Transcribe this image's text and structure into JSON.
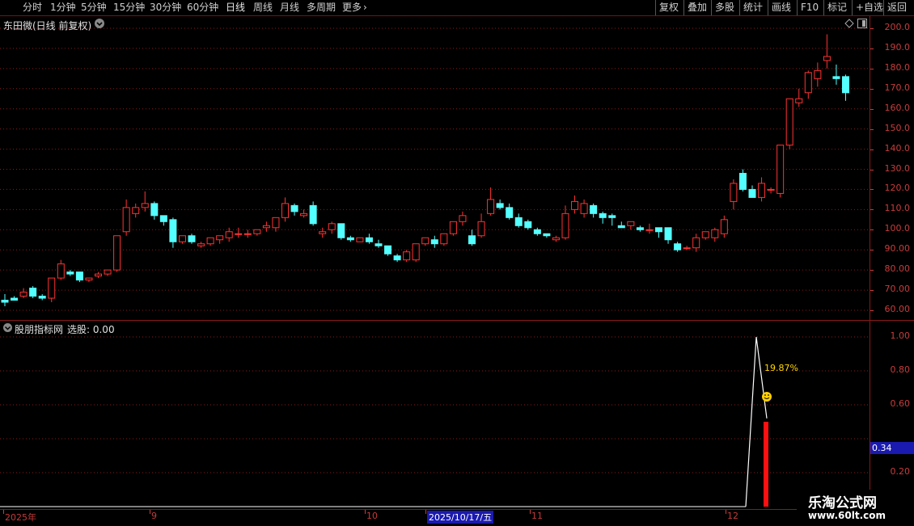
{
  "toolbar": {
    "periods": [
      "分时",
      "1分钟",
      "5分钟",
      "15分钟",
      "30分钟",
      "60分钟",
      "日线",
      "周线",
      "月线",
      "多周期",
      "更多"
    ],
    "active": "日线",
    "more_chevron": "›",
    "right_buttons": [
      "复权",
      "叠加",
      "多股",
      "统计",
      "画线",
      "F10",
      "标记",
      "+自选",
      "返回"
    ]
  },
  "main_panel": {
    "title": "东田微(日线 前复权)",
    "y_ticks": [
      "200.0",
      "190.0",
      "180.0",
      "170.0",
      "160.0",
      "150.0",
      "140.0",
      "130.0",
      "120.0",
      "110.0",
      "100.0",
      "90.00",
      "80.00",
      "70.00",
      "60.00"
    ]
  },
  "sub_panel": {
    "title": "股朋指标网",
    "select_label": "选股: 0.00",
    "y_ticks": [
      "1.00",
      "0.80",
      "0.60",
      "0.40",
      "0.20"
    ],
    "current_value": "0.34",
    "annotation": "19.87%"
  },
  "date_axis": {
    "labels": [
      "2025年",
      "9",
      "10",
      "2025/10/17/五",
      "11",
      "12"
    ]
  },
  "watermark": {
    "line1": "乐淘公式网",
    "line2": "www.60lt.com"
  },
  "colors": {
    "up": "#ff3232",
    "down": "#54ffff",
    "axis": "#c83c3c",
    "grid": "#8b1a1a",
    "highlight_bg": "#1a1ab0"
  },
  "chart_data": {
    "type": "candlestick",
    "ylim": [
      55,
      205
    ],
    "candles": [
      [
        65,
        68,
        64,
        62
      ],
      [
        66,
        67,
        65,
        65
      ],
      [
        67,
        71,
        69,
        66
      ],
      [
        71,
        72,
        67,
        66
      ],
      [
        67,
        68,
        66,
        65
      ],
      [
        66,
        76,
        76,
        64
      ],
      [
        76,
        85,
        83,
        75
      ],
      [
        79,
        80,
        78,
        77
      ],
      [
        79,
        79,
        75,
        74
      ],
      [
        75,
        76,
        76,
        74
      ],
      [
        77,
        79,
        78,
        76
      ],
      [
        78,
        80,
        80,
        77
      ],
      [
        80,
        97,
        97,
        79
      ],
      [
        99,
        115,
        111,
        97
      ],
      [
        108,
        113,
        111,
        106
      ],
      [
        111,
        119,
        113,
        109
      ],
      [
        113,
        114,
        107,
        105
      ],
      [
        107,
        107,
        104,
        102
      ],
      [
        105,
        106,
        94,
        91
      ],
      [
        94,
        97,
        97,
        93
      ],
      [
        97,
        98,
        94,
        93
      ],
      [
        92,
        94,
        93,
        91
      ],
      [
        93,
        95,
        96,
        92
      ],
      [
        95,
        97,
        97,
        93
      ],
      [
        96,
        101,
        99,
        94
      ],
      [
        98,
        101,
        98,
        96
      ],
      [
        98,
        100,
        98,
        96
      ],
      [
        98,
        100,
        100,
        97
      ],
      [
        101,
        104,
        102,
        99
      ],
      [
        101,
        106,
        106,
        99
      ],
      [
        106,
        116,
        113,
        104
      ],
      [
        112,
        113,
        109,
        107
      ],
      [
        107,
        110,
        108,
        106
      ],
      [
        112,
        114,
        103,
        102
      ],
      [
        98,
        101,
        99,
        96
      ],
      [
        100,
        104,
        103,
        98
      ],
      [
        103,
        103,
        96,
        95
      ],
      [
        96,
        97,
        95,
        94
      ],
      [
        94,
        96,
        96,
        94
      ],
      [
        96,
        98,
        94,
        93
      ],
      [
        93,
        95,
        92,
        91
      ],
      [
        92,
        90,
        88,
        87
      ],
      [
        87,
        88,
        85,
        84
      ],
      [
        85,
        90,
        89,
        84
      ],
      [
        85,
        93,
        93,
        84
      ],
      [
        93,
        96,
        96,
        92
      ],
      [
        95,
        97,
        93,
        91
      ],
      [
        93,
        98,
        98,
        92
      ],
      [
        98,
        104,
        104,
        97
      ],
      [
        104,
        109,
        107,
        102
      ],
      [
        97,
        100,
        93,
        92
      ],
      [
        97,
        108,
        104,
        96
      ],
      [
        108,
        121,
        115,
        107
      ],
      [
        113,
        115,
        111,
        110
      ],
      [
        111,
        113,
        106,
        105
      ],
      [
        106,
        108,
        102,
        101
      ],
      [
        104,
        105,
        101,
        100
      ],
      [
        100,
        101,
        98,
        97
      ],
      [
        98,
        98,
        97,
        96
      ],
      [
        95,
        97,
        96,
        94
      ],
      [
        96,
        112,
        108,
        95
      ],
      [
        110,
        117,
        114,
        108
      ],
      [
        108,
        115,
        113,
        106
      ],
      [
        112,
        113,
        108,
        106
      ],
      [
        108,
        109,
        106,
        103
      ],
      [
        107,
        108,
        106,
        102
      ],
      [
        102,
        104,
        101,
        101
      ],
      [
        102,
        104,
        104,
        100
      ],
      [
        101,
        102,
        100,
        99
      ],
      [
        100,
        103,
        100,
        98
      ],
      [
        101,
        101,
        99,
        96
      ],
      [
        101,
        101,
        95,
        93
      ],
      [
        93,
        94,
        90,
        89
      ],
      [
        91,
        92,
        91,
        90
      ],
      [
        91,
        98,
        96,
        89
      ],
      [
        96,
        99,
        99,
        95
      ],
      [
        96,
        101,
        100,
        94
      ],
      [
        98,
        107,
        105,
        96
      ],
      [
        114,
        125,
        123,
        110
      ],
      [
        128,
        130,
        120,
        119
      ],
      [
        120,
        122,
        116,
        116
      ],
      [
        116,
        126,
        123,
        114
      ],
      [
        120,
        121,
        120,
        118
      ],
      [
        118,
        139,
        142,
        116
      ],
      [
        142,
        165,
        165,
        140
      ],
      [
        163,
        170,
        165,
        161
      ],
      [
        168,
        179,
        178,
        165
      ],
      [
        175,
        183,
        179,
        171
      ],
      [
        184,
        197,
        186,
        180
      ],
      [
        176,
        182,
        175,
        172
      ],
      [
        176,
        177,
        168,
        164
      ]
    ],
    "indicator": {
      "line_points": [
        [
          0.0,
          0.0
        ],
        [
          0.82,
          0.0
        ],
        [
          0.84,
          0.0
        ],
        [
          0.855,
          1.0
        ],
        [
          0.87,
          0.5
        ]
      ],
      "bar_value": 0.5
    }
  }
}
